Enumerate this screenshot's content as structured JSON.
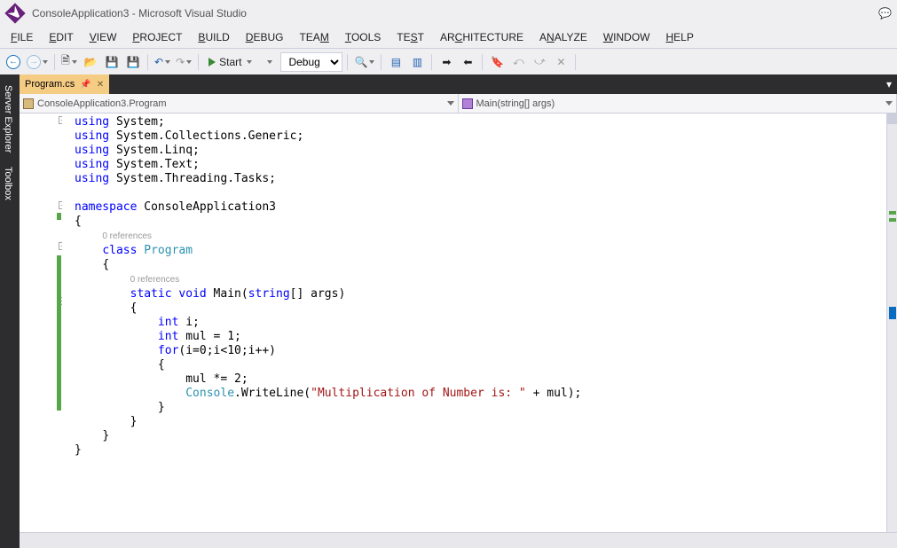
{
  "title": "ConsoleApplication3 - Microsoft Visual Studio",
  "menu": [
    "FILE",
    "EDIT",
    "VIEW",
    "PROJECT",
    "BUILD",
    "DEBUG",
    "TEAM",
    "TOOLS",
    "TEST",
    "ARCHITECTURE",
    "ANALYZE",
    "WINDOW",
    "HELP"
  ],
  "menu_underline_idx": [
    0,
    0,
    0,
    0,
    0,
    0,
    3,
    0,
    3,
    2,
    1,
    0,
    0
  ],
  "toolbar": {
    "start_label": "Start",
    "config": "Debug"
  },
  "side_tabs": [
    "Server Explorer",
    "Toolbox"
  ],
  "doc_tab": {
    "name": "Program.cs"
  },
  "nav": {
    "left": "ConsoleApplication3.Program",
    "right": "Main(string[] args)"
  },
  "refs": {
    "zero": "0 references"
  },
  "code": {
    "l1": {
      "kw": "using",
      "rest": " System;"
    },
    "l2": {
      "kw": "using",
      "rest": " System.Collections.Generic;"
    },
    "l3": {
      "kw": "using",
      "rest": " System.Linq;"
    },
    "l4": {
      "kw": "using",
      "rest": " System.Text;"
    },
    "l5": {
      "kw": "using",
      "rest": " System.Threading.Tasks;"
    },
    "ns_kw": "namespace",
    "ns_name": " ConsoleApplication3",
    "brace_o": "{",
    "brace_c": "}",
    "class_kw": "class",
    "class_name": "Program",
    "static_kw": "static",
    "void_kw": "void",
    "main_name": " Main(",
    "string_kw": "string",
    "args_rest": "[] args)",
    "int_kw": "int",
    "decl_i": " i;",
    "decl_mul": " mul = 1;",
    "for_kw": "for",
    "for_body": "(i=0;i<10;i++)",
    "mul_line": "mul *= 2;",
    "console_typ": "Console",
    "write_call": ".WriteLine(",
    "str_lit": "\"Multiplication of Number is: \"",
    "write_rest": " + mul);"
  }
}
